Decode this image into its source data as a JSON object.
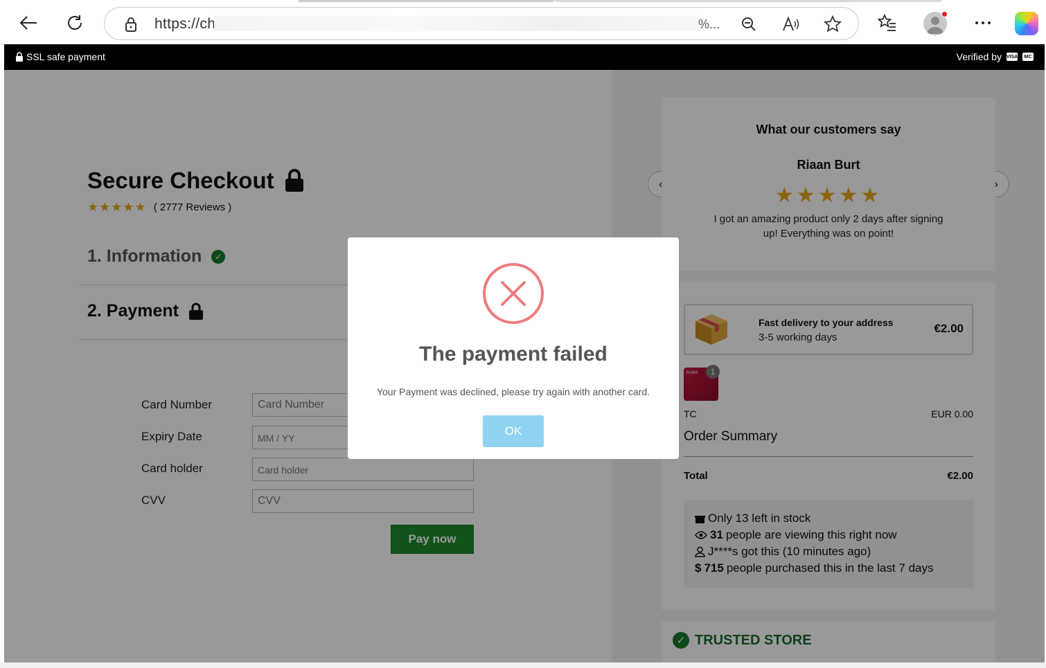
{
  "browser": {
    "url_prefix": "https://ch",
    "url_suffix": "%..."
  },
  "topbar": {
    "ssl_label": "SSL safe payment",
    "verified_label": "Verified by",
    "pay_logo_1": "VISA",
    "pay_logo_2": "MC"
  },
  "checkout": {
    "title": "Secure Checkout",
    "stars": "★★★★★",
    "reviews": "( 2777 Reviews )",
    "step1": "1. Information",
    "step2": "2. Payment",
    "fields": {
      "card_number_label": "Card Number",
      "card_number_placeholder": "Card Number",
      "expiry_label": "Expiry Date",
      "expiry_placeholder": "MM / YY",
      "holder_label": "Card holder",
      "holder_placeholder": "Card holder",
      "cvv_label": "CVV",
      "cvv_placeholder": "CVV"
    },
    "pay_button": "Pay now"
  },
  "testimonial": {
    "heading": "What our customers say",
    "name": "Riaan Burt",
    "stars": "★★★★★",
    "quote": "I got an amazing product only 2 days after signing up! Everything was on point!",
    "prev": "‹",
    "next": "›"
  },
  "summary": {
    "delivery_title": "Fast delivery to your address",
    "delivery_sub": "3-5 working days",
    "delivery_price": "€2.00",
    "product_qty": "1",
    "product_name": "TC",
    "product_price": "EUR 0.00",
    "thumb_text": "SUMA",
    "order_summary": "Order Summary",
    "total_label": "Total",
    "total_value": "€2.00",
    "stock": {
      "line1": "Only 13 left in stock",
      "line2_num": "31",
      "line2_text": "people are viewing this right now",
      "line3": "J****s got this (10 minutes ago)",
      "line4_num": "715",
      "line4_text": "people purchased this in the last 7 days"
    },
    "trusted": "TRUSTED STORE"
  },
  "modal": {
    "title": "The payment failed",
    "message": "Your Payment was declined, please try again with another card.",
    "ok": "OK",
    "error_color": "#ee7b7b",
    "ok_color": "#8fd3f1"
  }
}
